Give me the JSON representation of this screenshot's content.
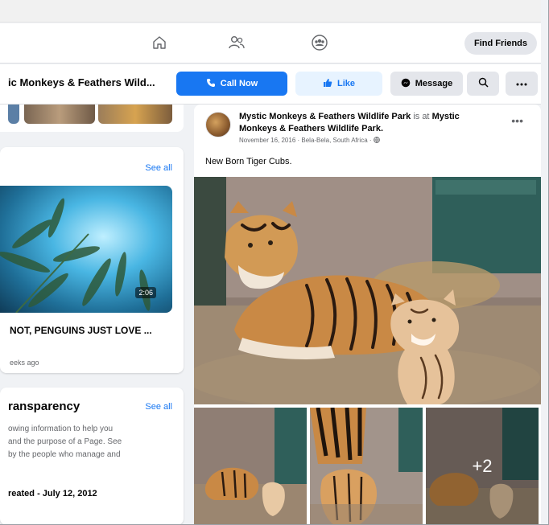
{
  "topnav": {
    "icons": [
      "home-icon",
      "friends-icon",
      "groups-icon"
    ],
    "find_friends_label": "Find Friends"
  },
  "pagebar": {
    "page_name": "ic Monkeys & Feathers Wild...",
    "call_now_label": "Call Now",
    "like_label": "Like",
    "message_label": "Message",
    "search_icon": "search-icon",
    "more_icon": "more-icon"
  },
  "videos_card": {
    "see_all_label": "See all",
    "video": {
      "duration": "2:06",
      "title": "NOT, PENGUINS JUST LOVE ...",
      "meta": "eeks ago"
    }
  },
  "transparency_card": {
    "title": "ransparency",
    "see_all_label": "See all",
    "body_lines": [
      "owing information to help you",
      "and the purpose of a Page. See",
      "by the people who manage and"
    ],
    "created": "reated - July 12, 2012"
  },
  "post": {
    "page_name": "Mystic Monkeys & Feathers Wildlife Park",
    "is_at": "is at",
    "location_name": "Mystic Monkeys & Feathers Wildlife Park.",
    "date_line": "November 16, 2016 · Bela-Bela, South Africa ·",
    "text": "New Born Tiger Cubs.",
    "more_photos_count": "+2"
  },
  "colors": {
    "brand_blue": "#1877f2",
    "like_bg": "#e7f3ff",
    "page_bg": "#f0f2f5",
    "secondary_text": "#65676b"
  }
}
